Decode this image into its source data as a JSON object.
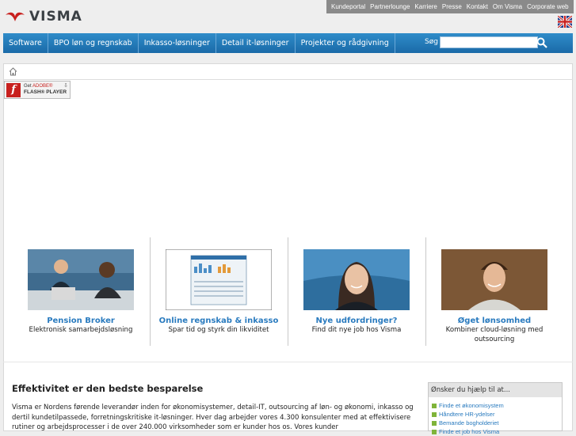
{
  "brand": {
    "name": "VISMA",
    "accent": "#2f8cc9",
    "logo_red": "#c8201e"
  },
  "utility_links": [
    "Kundeportal",
    "Partnerlounge",
    "Karriere",
    "Presse",
    "Kontakt",
    "Om Visma",
    "Corporate web"
  ],
  "language_flag": "uk-flag-icon",
  "nav": {
    "items": [
      "Software",
      "BPO løn og regnskab",
      "Inkasso-løsninger",
      "Detail it-løsninger",
      "Projekter og rådgivning"
    ],
    "search_label": "Søg",
    "search_value": ""
  },
  "flash_badge": {
    "get": "Get",
    "adobe": "ADOBE®",
    "product": "FLASH® PLAYER"
  },
  "cards": [
    {
      "title": "Pension Broker",
      "sub": "Elektronisk samarbejdsløsning"
    },
    {
      "title": "Online regnskab & inkasso",
      "sub": "Spar tid og styrk din likviditet"
    },
    {
      "title": "Nye udfordringer?",
      "sub": "Find dit nye job hos Visma"
    },
    {
      "title": "Øget lønsomhed",
      "sub": "Kombiner cloud-løsning med outsourcing"
    }
  ],
  "article": {
    "heading": "Effektivitet er den bedste besparelse",
    "body": "Visma er Nordens førende leverandør inden for økonomisystemer, detail-IT, outsourcing af løn- og økonomi, inkasso og dertil kundetilpassede, forretningskritiske it-løsninger. Hver dag arbejder vores 4.300 konsulenter med at effektivisere rutiner og arbejdsprocesser i de over 240.000 virksomheder som er kunder hos os. Vores kunder"
  },
  "help": {
    "heading": "Ønsker du hjælp til at...",
    "links": [
      "Finde et økonomisystem",
      "Håndtere HR-ydelser",
      "Bemande bogholderiet",
      "Finde et job hos Visma"
    ]
  }
}
